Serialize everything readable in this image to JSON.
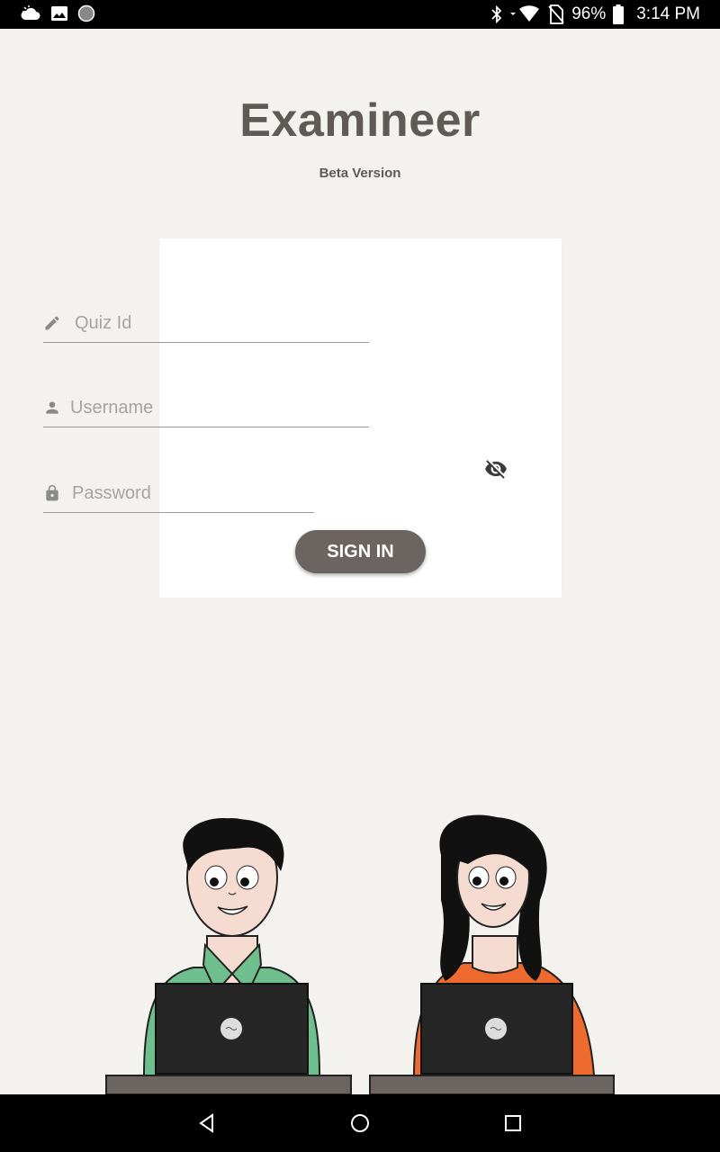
{
  "status_bar": {
    "battery": "96%",
    "time": "3:14 PM",
    "icons": [
      "weather-icon",
      "image-notification-icon",
      "circle-notification-icon",
      "bluetooth-icon",
      "wifi-icon",
      "no-sim-icon",
      "battery-icon"
    ]
  },
  "app": {
    "title": "Examineer",
    "subtitle": "Beta Version"
  },
  "form": {
    "quiz_placeholder": "Quiz Id",
    "username_placeholder": "Username",
    "password_placeholder": "Password",
    "signin_label": "SIGN IN",
    "icons": [
      "pencil-icon",
      "person-icon",
      "lock-icon",
      "visibility-off-icon"
    ]
  },
  "colors": {
    "background": "#f3f2ef",
    "accent": "#6b6460",
    "title": "#5f5a55",
    "boy_shirt": "#6fbf8e",
    "girl_shirt": "#ee6a2e"
  },
  "nav": {
    "icons": [
      "back-icon",
      "home-icon",
      "recents-icon"
    ]
  }
}
